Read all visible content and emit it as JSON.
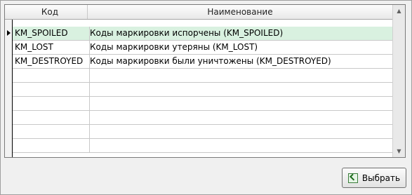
{
  "table": {
    "columns": [
      {
        "label": "Код"
      },
      {
        "label": "Наименование"
      }
    ],
    "rows": [
      {
        "code": "KM_SPOILED",
        "name": "Коды маркировки испорчены (KM_SPOILED)",
        "selected": true
      },
      {
        "code": "KM_LOST",
        "name": "Коды маркировки утеряны (KM_LOST)",
        "selected": false
      },
      {
        "code": "KM_DESTROYED",
        "name": "Коды маркировки были уничтожены (KM_DESTROYED)",
        "selected": false
      }
    ]
  },
  "buttons": {
    "select_label": "Выбрать",
    "select_icon": "select-check-icon"
  },
  "colors": {
    "selected_row": "#d9f1e0"
  }
}
